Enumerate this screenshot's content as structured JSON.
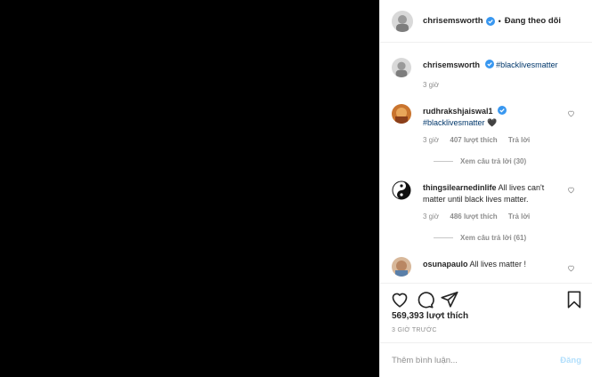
{
  "post": {
    "author": "chrisemsworth",
    "follow_status": "Đang theo dõi",
    "caption_tag": "#blacklivesmatter",
    "caption_time": "3 giờ",
    "likes": "569,393 lượt thích",
    "posted": "3 GIỜ TRƯỚC",
    "verified_color": "#3897f0"
  },
  "comments": [
    {
      "user": "rudhrakshjaiswal1",
      "text": "#blacklivesmatter 🖤",
      "time": "3 giờ",
      "likes": "407 lượt thích",
      "reply": "Trả lời",
      "view_replies": "Xem câu trả lời (30)"
    },
    {
      "user": "thingsilearnedinlife",
      "text": "All lives can't matter until black lives matter.",
      "time": "3 giờ",
      "likes": "486 lượt thích",
      "reply": "Trả lời",
      "view_replies": "Xem câu trả lời (61)"
    },
    {
      "user": "osunapaulo",
      "text": "All lives matter !"
    }
  ],
  "composer": {
    "placeholder": "Thêm bình luận...",
    "post_label": "Đăng"
  },
  "icons": [
    "heart-icon",
    "comment-icon",
    "share-icon",
    "bookmark-icon",
    "verified-icon"
  ]
}
